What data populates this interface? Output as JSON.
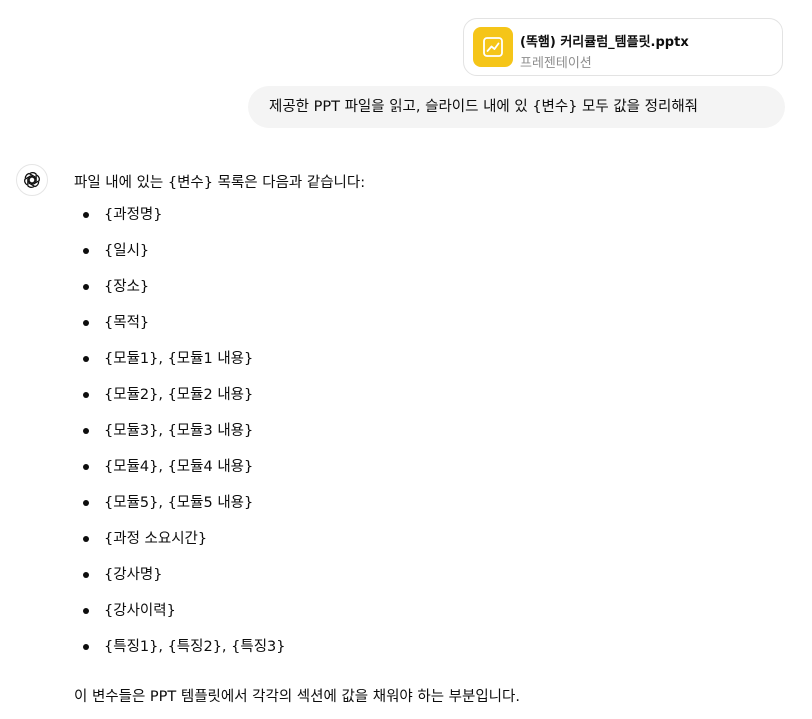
{
  "attachment": {
    "file_name": "(똑햄) 커리큘럼_템플릿.pptx",
    "file_type": "프레젠테이션",
    "icon": "presentation-icon",
    "icon_color": "#f5c518"
  },
  "user_message": "제공한 PPT 파일을 읽고, 슬라이드 내에 있 {변수} 모두 값을 정리해줘",
  "assistant": {
    "avatar_icon": "openai-logo-icon",
    "intro": "파일 내에 있는 {변수} 목록은 다음과 같습니다:",
    "variables": [
      "{과정명}",
      "{일시}",
      "{장소}",
      "{목적}",
      "{모듈1}, {모듈1 내용}",
      "{모듈2}, {모듈2 내용}",
      "{모듈3}, {모듈3 내용}",
      "{모듈4}, {모듈4 내용}",
      "{모듈5}, {모듈5 내용}",
      "{과정 소요시간}",
      "{강사명}",
      "{강사이력}",
      "{특징1}, {특징2}, {특징3}"
    ],
    "outro": "이 변수들은 PPT 템플릿에서 각각의 섹션에 값을 채워야 하는 부분입니다."
  }
}
